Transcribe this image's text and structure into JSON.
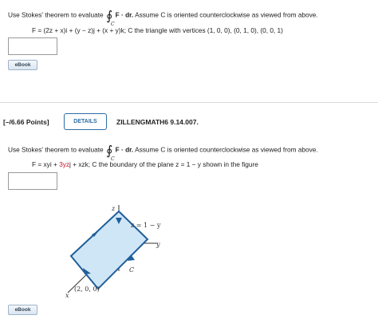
{
  "q1": {
    "intro": "Use Stokes' theorem to evaluate",
    "integral_sub": "C",
    "integrand": "F · dr.",
    "after": "Assume C is oriented counterclockwise as viewed from above.",
    "formula": "F = (2z + x)i + (y − z)j + (x + y)k; C the triangle with vertices (1, 0, 0), (0, 1, 0), (0, 0, 1)",
    "ebook": "eBook"
  },
  "q2": {
    "points": "[–/6.66 Points]",
    "details": "DETAILS",
    "qid": "ZILLENGMATH6 9.14.007.",
    "intro": "Use Stokes' theorem to evaluate",
    "integral_sub": "C",
    "integrand": "F · dr.",
    "after": "Assume C is oriented counterclockwise as viewed from above.",
    "formula_prefix": "F = xyi + ",
    "formula_red": "3yz",
    "formula_suffix": "j + xzk; C the boundary of the plane z = 1 − y shown in the figure",
    "ebook": "eBook"
  },
  "figure": {
    "z_label": "z",
    "y_label": "y",
    "x_label": "x",
    "plane_label": "z = 1 − y",
    "curve_label": "C",
    "point_label": "(2, 0, 0)",
    "plane_color": "#cfe6f7",
    "edge_color": "#1f5f99"
  }
}
